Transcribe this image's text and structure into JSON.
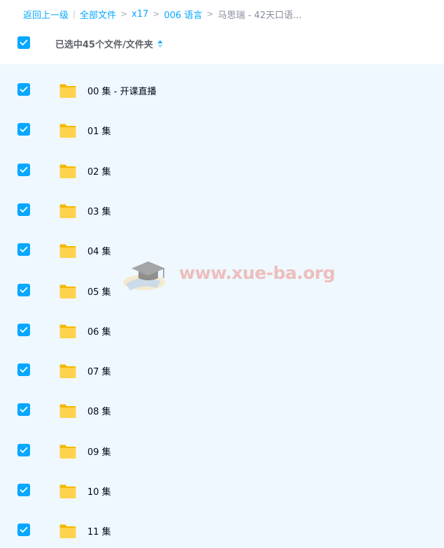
{
  "breadcrumb": {
    "back": "返回上一级",
    "all_files": "全部文件",
    "crumb1": "x17",
    "crumb2": "006 语言",
    "current": "马思瑞 - 42天口语...",
    "sep_bar": "|",
    "sep": ">"
  },
  "header": {
    "selected_label": "已选中45个文件/文件夹"
  },
  "rows": [
    {
      "name": "00 集 - 开课直播"
    },
    {
      "name": "01 集"
    },
    {
      "name": "02 集"
    },
    {
      "name": "03 集"
    },
    {
      "name": "04 集"
    },
    {
      "name": "05 集"
    },
    {
      "name": "06 集"
    },
    {
      "name": "07 集"
    },
    {
      "name": "08 集"
    },
    {
      "name": "09 集"
    },
    {
      "name": "10 集"
    },
    {
      "name": "11 集"
    }
  ],
  "watermark": {
    "text": "www.xue-ba.org"
  },
  "colors": {
    "accent": "#06a7ff",
    "list_bg": "#eef8fe",
    "folder": "#ffd24d",
    "watermark": "#ec786e"
  }
}
